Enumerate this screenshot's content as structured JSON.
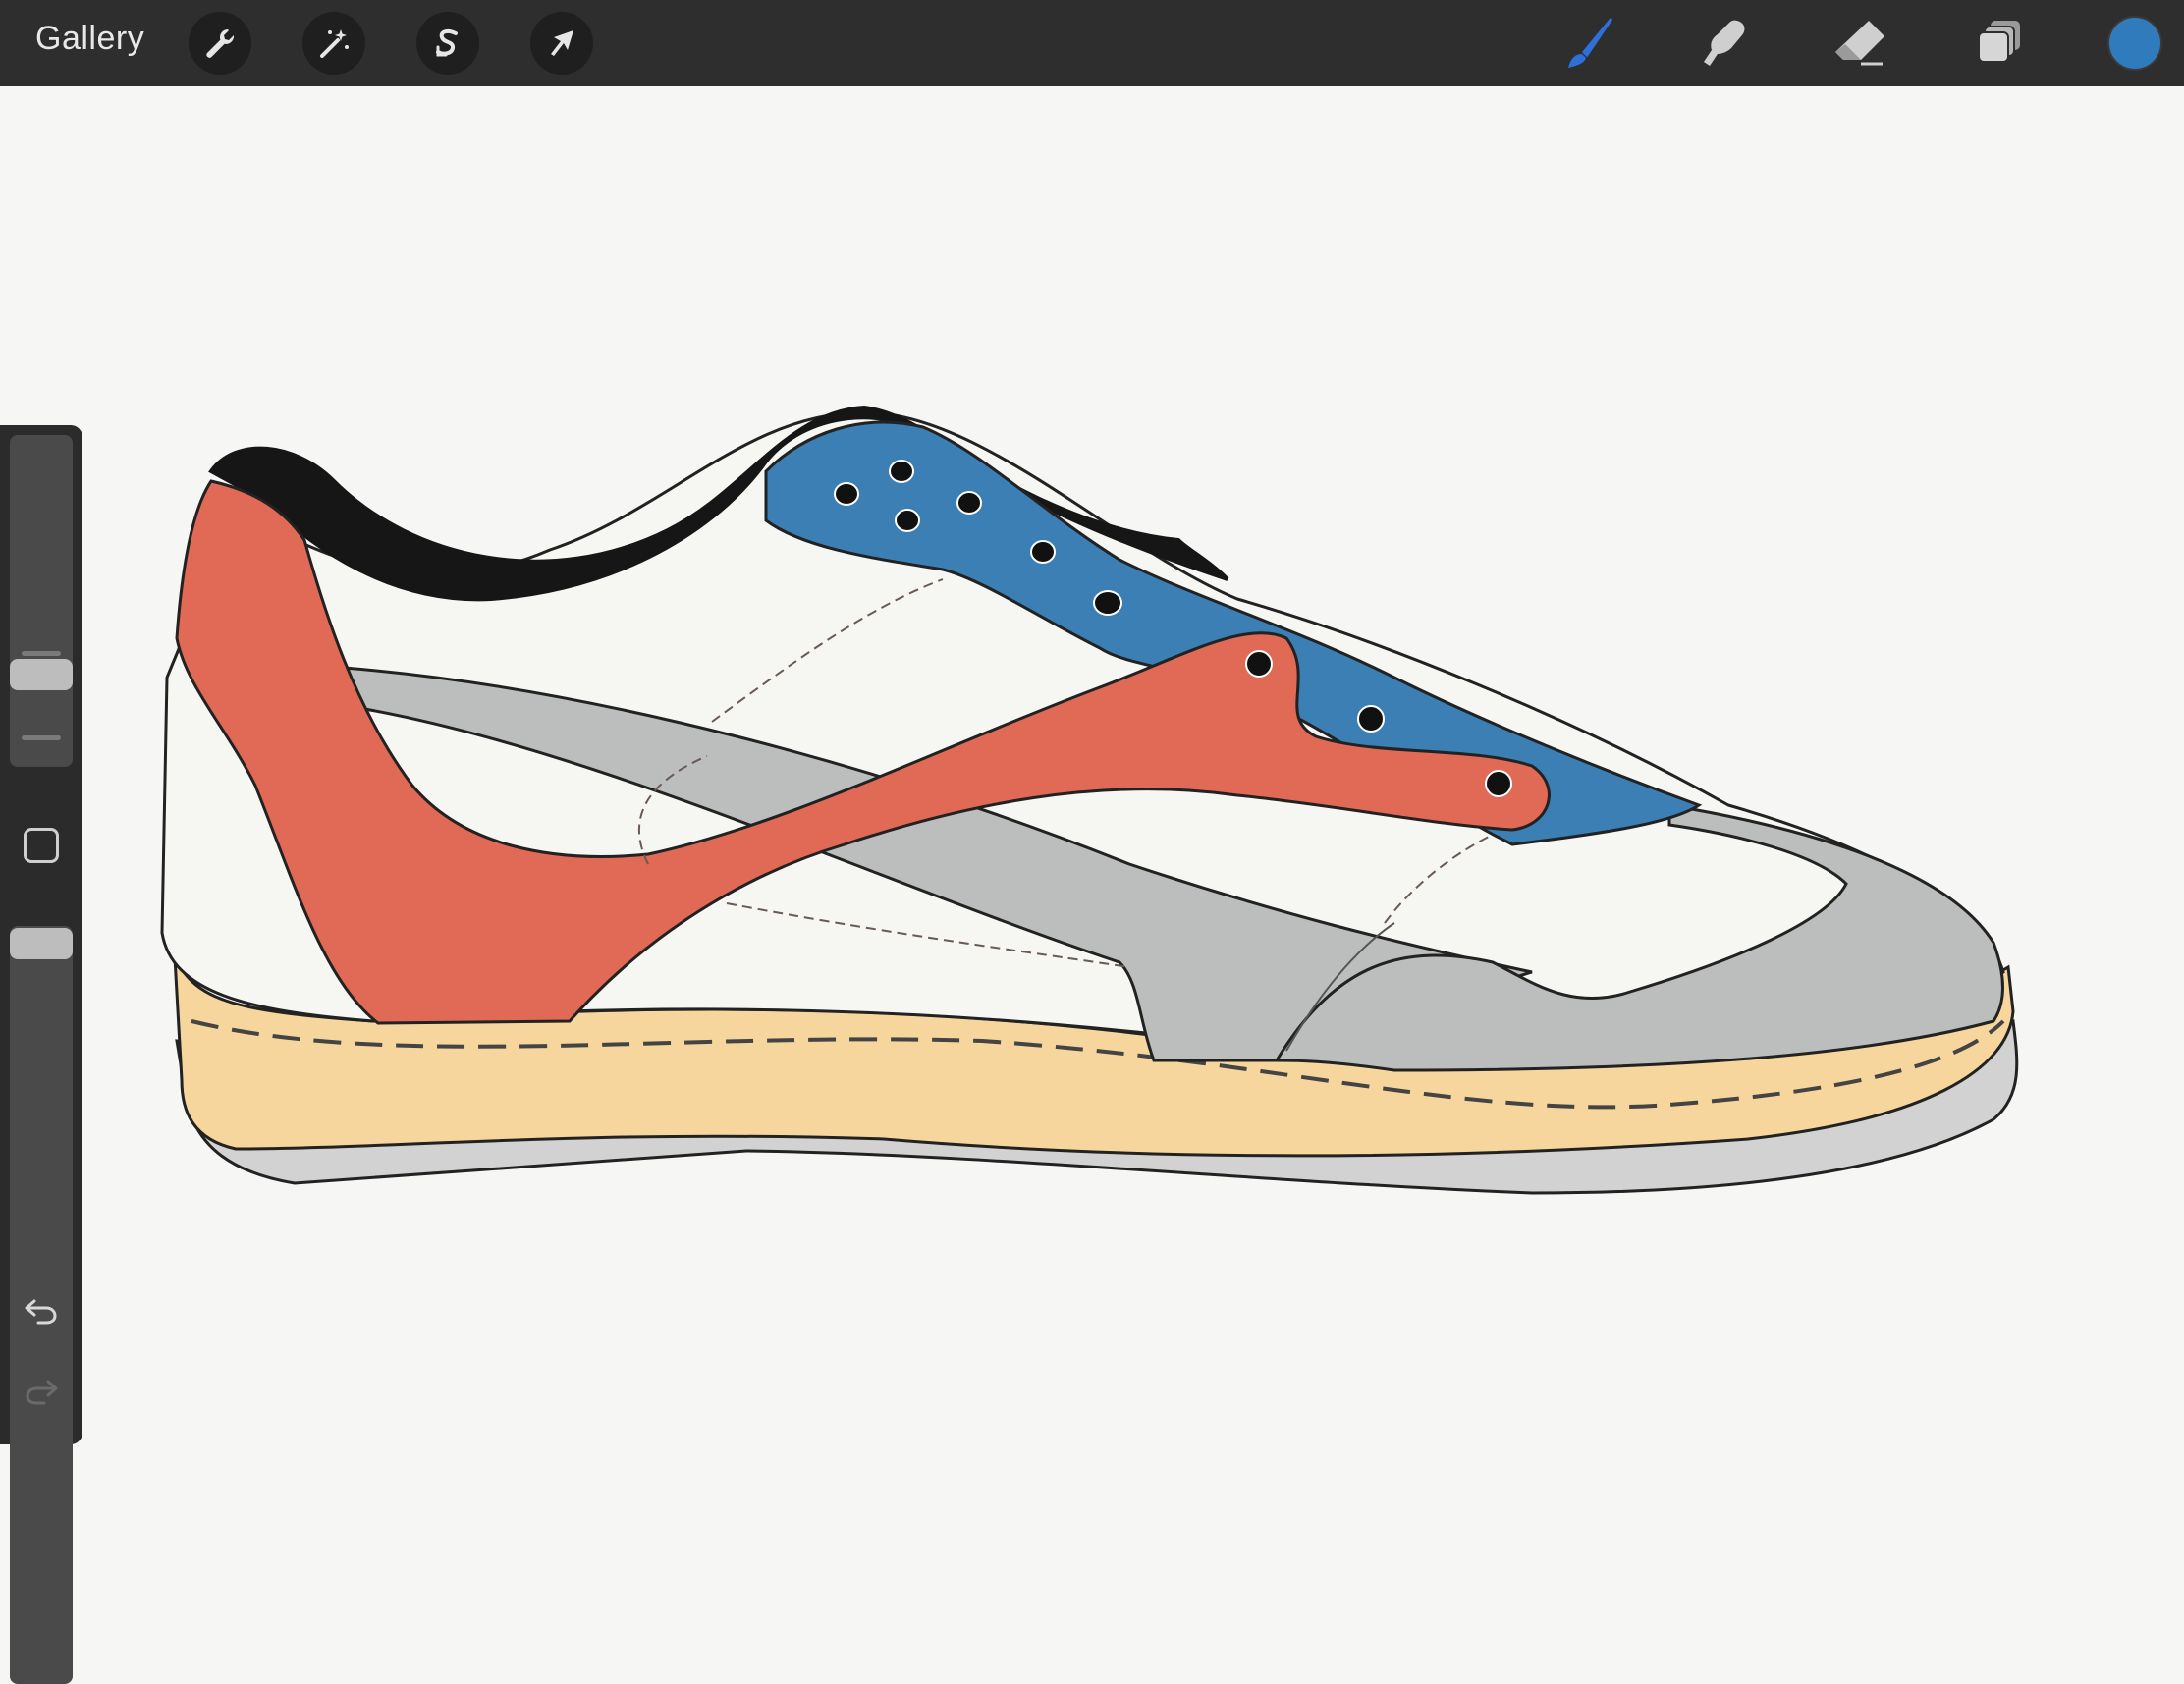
{
  "app": {
    "gallery_label": "Gallery"
  },
  "toolbar": {
    "left_tools": [
      {
        "name": "actions",
        "icon": "wrench-icon"
      },
      {
        "name": "adjustments",
        "icon": "magic-wand-icon"
      },
      {
        "name": "selection",
        "icon": "selection-s-icon"
      },
      {
        "name": "transform",
        "icon": "arrow-cursor-icon"
      }
    ],
    "right_tools": [
      {
        "name": "brush",
        "icon": "paintbrush-icon",
        "active": true,
        "color": "#2f6fd8"
      },
      {
        "name": "smudge",
        "icon": "smudge-finger-icon",
        "active": false
      },
      {
        "name": "eraser",
        "icon": "eraser-icon",
        "active": false
      },
      {
        "name": "layers",
        "icon": "layers-icon",
        "active": false
      }
    ],
    "current_color": "#2f7bbc"
  },
  "sidebar": {
    "brush_size_level": 0.6,
    "opacity_level": 1.0,
    "undo_icon": "undo-arrow-icon",
    "redo_icon": "redo-arrow-icon",
    "modify_icon": "square-modify-icon"
  },
  "artwork": {
    "subject": "sneaker",
    "colors": {
      "collar": "#161616",
      "heel_swoosh": "#e06a55",
      "eyestay": "#3b7fb4",
      "overlay_gray": "#bcbdbd",
      "upper_white": "#f6f6f3",
      "midsole": "#f6d69c",
      "outsole": "#d2d2d2"
    }
  }
}
